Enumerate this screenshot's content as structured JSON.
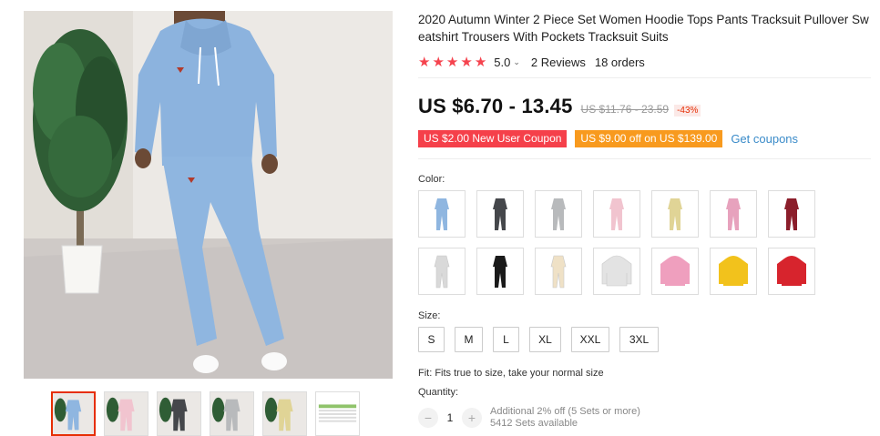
{
  "product": {
    "title": "2020 Autumn Winter 2 Piece Set Women Hoodie Tops Pants Tracksuit Pullover Sweatshirt Trousers With Pockets Tracksuit Suits",
    "rating": {
      "stars": 5,
      "score": "5.0",
      "reviews": "2 Reviews",
      "orders": "18 orders"
    },
    "price": "US $6.70 - 13.45",
    "old_price": "US $11.76 - 23.59",
    "discount": "-43%",
    "coupons": {
      "new_user": "US $2.00 New User Coupon",
      "offer": "US $9.00 off on US $139.00",
      "get_label": "Get coupons"
    }
  },
  "colors": {
    "label": "Color:",
    "swatches": [
      {
        "name": "light-blue",
        "color": "#8fb6e0",
        "style": "set"
      },
      {
        "name": "dark-gray",
        "color": "#45474b",
        "style": "set"
      },
      {
        "name": "light-gray",
        "color": "#b8babc",
        "style": "set"
      },
      {
        "name": "pink",
        "color": "#f1c4cf",
        "style": "set"
      },
      {
        "name": "khaki",
        "color": "#e0d496",
        "style": "set"
      },
      {
        "name": "rose-pink",
        "color": "#e7a2bd",
        "style": "set"
      },
      {
        "name": "wine-red",
        "color": "#8b1e2b",
        "style": "set"
      },
      {
        "name": "white-gray",
        "color": "#d9d9d9",
        "style": "set"
      },
      {
        "name": "black",
        "color": "#1a1a1a",
        "style": "set"
      },
      {
        "name": "beige",
        "color": "#efe1c6",
        "style": "set"
      },
      {
        "name": "white-hoodie",
        "color": "#e3e3e3",
        "style": "hoodie"
      },
      {
        "name": "pink-hoodie",
        "color": "#ef9fbe",
        "style": "hoodie"
      },
      {
        "name": "yellow-hoodie",
        "color": "#f2c21c",
        "style": "hoodie"
      },
      {
        "name": "red-hoodie",
        "color": "#d7242d",
        "style": "hoodie"
      }
    ]
  },
  "size": {
    "label": "Size:",
    "options": [
      "S",
      "M",
      "L",
      "XL",
      "XXL",
      "3XL"
    ]
  },
  "fit_note": "Fit: Fits true to size, take your normal size",
  "quantity": {
    "label": "Quantity:",
    "value": "1",
    "minus": "−",
    "plus": "+",
    "note_discount": "Additional 2% off (5 Sets or more)",
    "note_available": "5412 Sets available"
  },
  "thumbnails": [
    {
      "color": "#8fb6e0"
    },
    {
      "color": "#f1c4cf"
    },
    {
      "color": "#45474b"
    },
    {
      "color": "#b8babc"
    },
    {
      "color": "#e0d496"
    },
    {
      "color": "size-chart"
    }
  ]
}
